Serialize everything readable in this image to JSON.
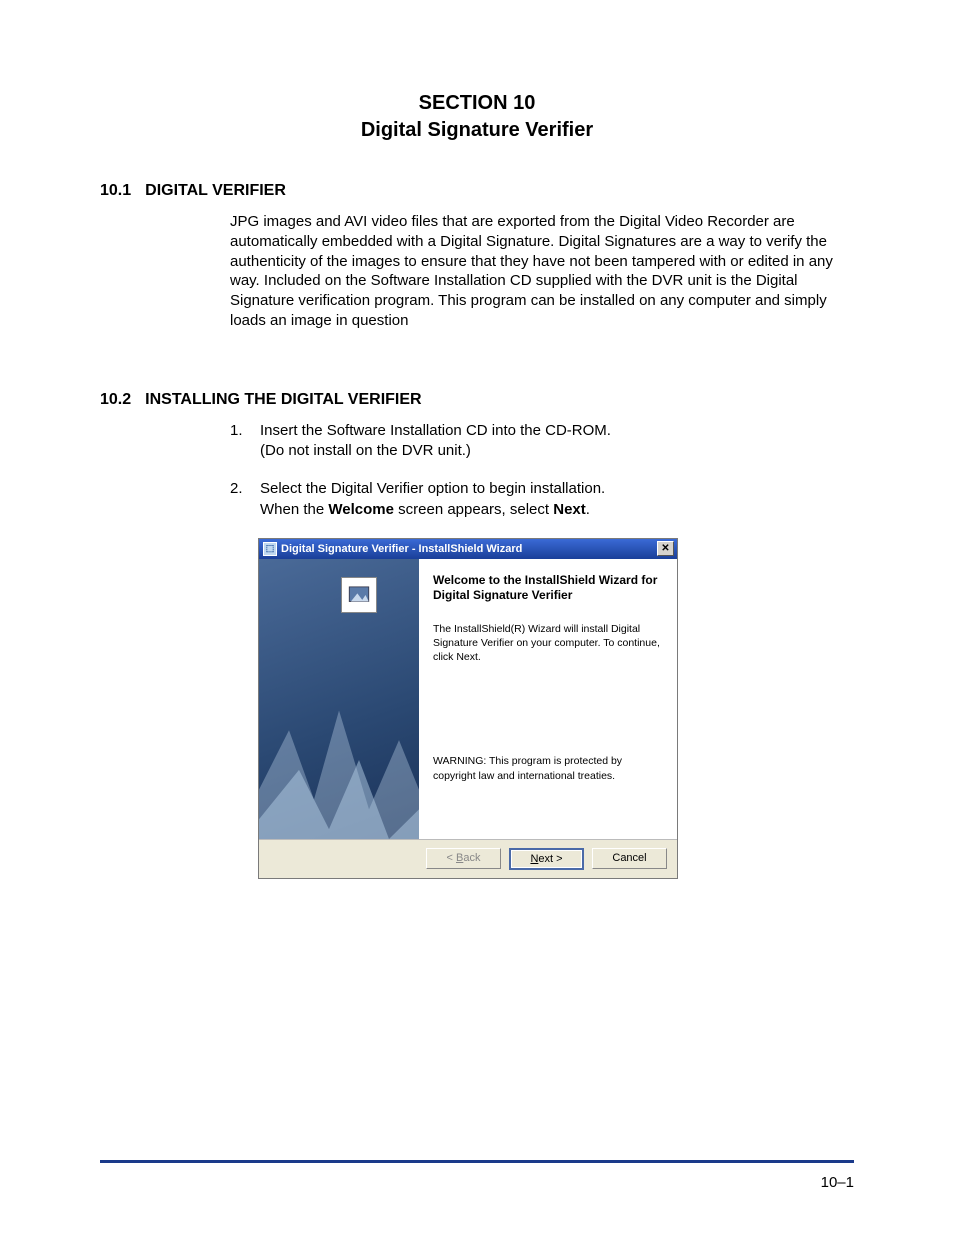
{
  "header": {
    "line1": "SECTION 10",
    "line2": "Digital Signature Verifier"
  },
  "s1": {
    "number": "10.1",
    "title": "DIGITAL VERIFIER",
    "body": "JPG images and AVI video files that are exported from the Digital Video Recorder are automatically embedded with a Digital Signature. Digital Signatures are a way to verify the authenticity of the images to ensure that they have not been tampered with or edited in any way. Included on the Software Installation CD supplied with the DVR unit is the Digital Signature verification program. This program can be installed on any computer and simply loads an image in question"
  },
  "s2": {
    "number": "10.2",
    "title": "INSTALLING THE DIGITAL VERIFIER",
    "steps": [
      {
        "num": "1.",
        "line1": "Insert the Software Installation CD into the CD-ROM.",
        "line2": "(Do not install on the DVR unit.)"
      },
      {
        "num": "2.",
        "line1": "Select the Digital Verifier option to begin installation.",
        "line2_pre": "When the ",
        "line2_b1": "Welcome",
        "line2_mid": " screen appears, select ",
        "line2_b2": "Next",
        "line2_post": "."
      }
    ]
  },
  "dialog": {
    "title": "Digital Signature Verifier - InstallShield Wizard",
    "heading": "Welcome to the InstallShield Wizard for Digital Signature Verifier",
    "text": "The InstallShield(R) Wizard will install Digital Signature Verifier on your computer. To continue, click Next.",
    "warning": "WARNING: This program is protected by copyright law and international treaties.",
    "back_pre": "< ",
    "back_u": "B",
    "back_post": "ack",
    "next_u": "N",
    "next_post": "ext >",
    "cancel": "Cancel"
  },
  "page_number": "10–1"
}
